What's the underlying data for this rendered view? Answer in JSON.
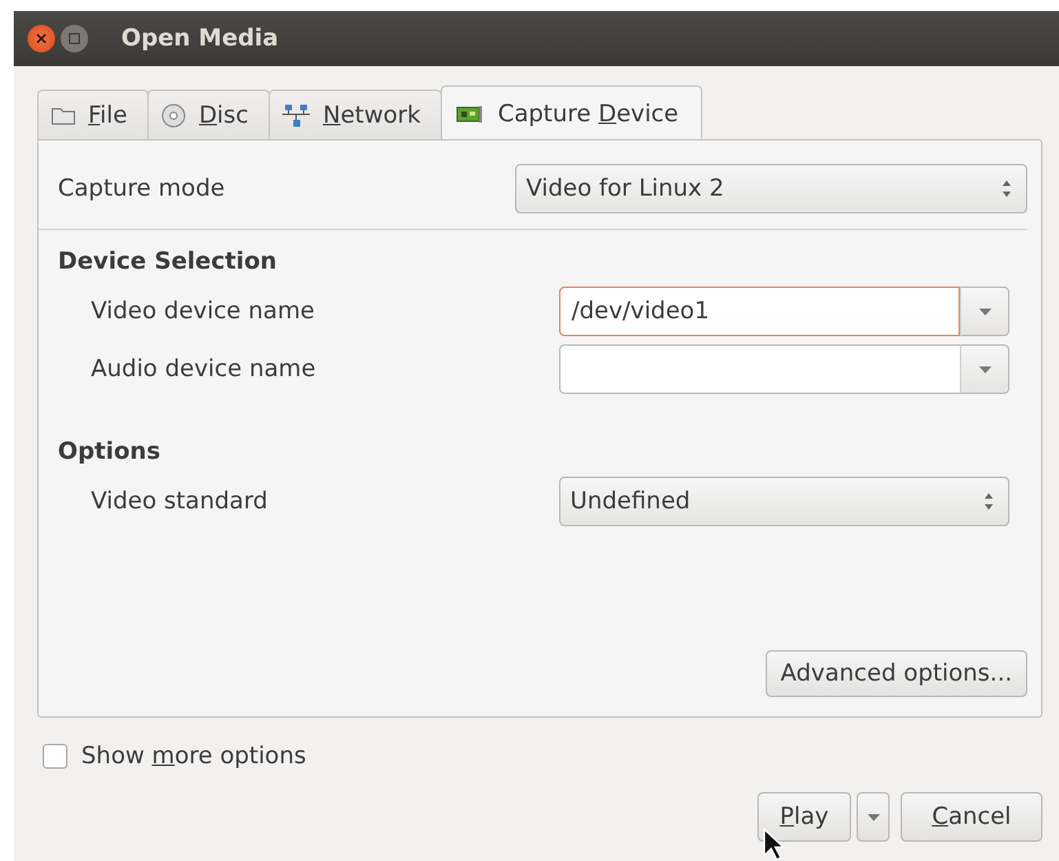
{
  "window": {
    "title": "Open Media"
  },
  "tabs": [
    {
      "kind": "folder",
      "key": "F",
      "post": "ile",
      "selected": false
    },
    {
      "kind": "disc",
      "key": "D",
      "post": "isc",
      "selected": false
    },
    {
      "kind": "network",
      "key": "N",
      "post": "etwork",
      "selected": false
    },
    {
      "kind": "card",
      "pre": "Capture ",
      "key": "D",
      "post": "evice",
      "selected": true
    }
  ],
  "capture_mode": {
    "label": "Capture mode",
    "value": "Video for Linux 2"
  },
  "device_selection": {
    "heading": "Device Selection",
    "fields": [
      {
        "label": "Video device name",
        "value": "/dev/video1",
        "focused": true
      },
      {
        "label": "Audio device name",
        "focused": false
      }
    ]
  },
  "options": {
    "heading": "Options",
    "video_standard": {
      "label": "Video standard",
      "value": "Undefined"
    }
  },
  "advanced_button": "Advanced options...",
  "show_more": {
    "pre": "Show ",
    "key": "m",
    "post": "ore options",
    "checked": false
  },
  "buttons": {
    "play": {
      "key": "P",
      "post": "lay"
    },
    "cancel": {
      "key": "C",
      "post": "ancel"
    }
  }
}
